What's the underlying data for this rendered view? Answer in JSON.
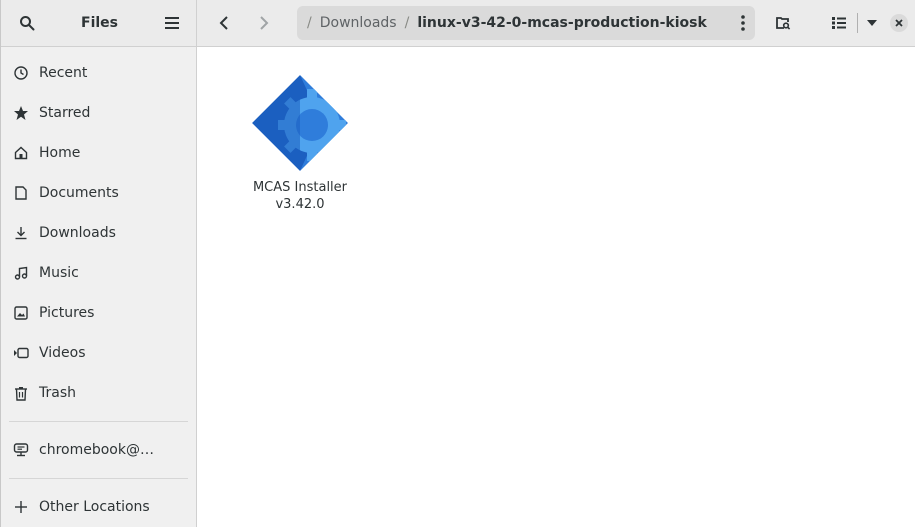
{
  "header": {
    "title": "Files",
    "path": {
      "parent": "Downloads",
      "current": "linux-v3-42-0-mcas-production-kiosk"
    }
  },
  "sidebar": {
    "items": [
      {
        "label": "Recent",
        "icon": "clock-icon"
      },
      {
        "label": "Starred",
        "icon": "star-icon"
      },
      {
        "label": "Home",
        "icon": "home-icon"
      },
      {
        "label": "Documents",
        "icon": "document-icon"
      },
      {
        "label": "Downloads",
        "icon": "download-icon"
      },
      {
        "label": "Music",
        "icon": "music-icon"
      },
      {
        "label": "Pictures",
        "icon": "picture-icon"
      },
      {
        "label": "Videos",
        "icon": "video-icon"
      },
      {
        "label": "Trash",
        "icon": "trash-icon"
      }
    ],
    "device": {
      "label": "chromebook@…",
      "icon": "computer-icon"
    },
    "other": {
      "label": "Other Locations",
      "icon": "plus-icon"
    }
  },
  "files": [
    {
      "name_line1": "MCAS Installer",
      "name_line2": "v3.42.0",
      "icon": "gear-diamond-icon",
      "colors": {
        "dark": "#1c5fc0",
        "light": "#4fa3ee"
      }
    }
  ]
}
